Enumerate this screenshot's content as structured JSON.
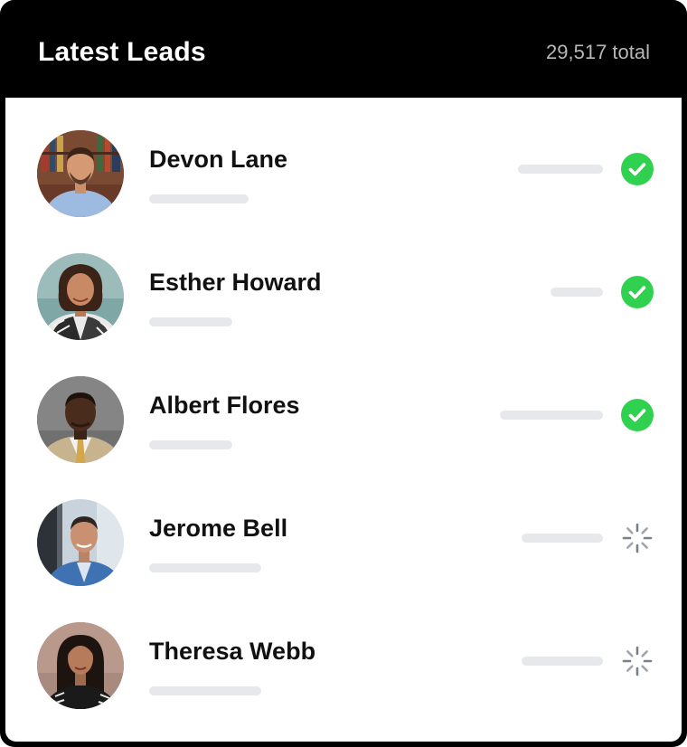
{
  "header": {
    "title": "Latest Leads",
    "total": "29,517 total"
  },
  "colors": {
    "success": "#2fd14f",
    "pending": "#7a8089",
    "placeholder": "#e6e8ec"
  },
  "leads": [
    {
      "name": "Devon Lane",
      "status": "completed",
      "status_icon": "check-circle-icon"
    },
    {
      "name": "Esther Howard",
      "status": "completed",
      "status_icon": "check-circle-icon"
    },
    {
      "name": "Albert Flores",
      "status": "completed",
      "status_icon": "check-circle-icon"
    },
    {
      "name": "Jerome Bell",
      "status": "pending",
      "status_icon": "spinner-icon"
    },
    {
      "name": "Theresa Webb",
      "status": "pending",
      "status_icon": "spinner-icon"
    }
  ]
}
